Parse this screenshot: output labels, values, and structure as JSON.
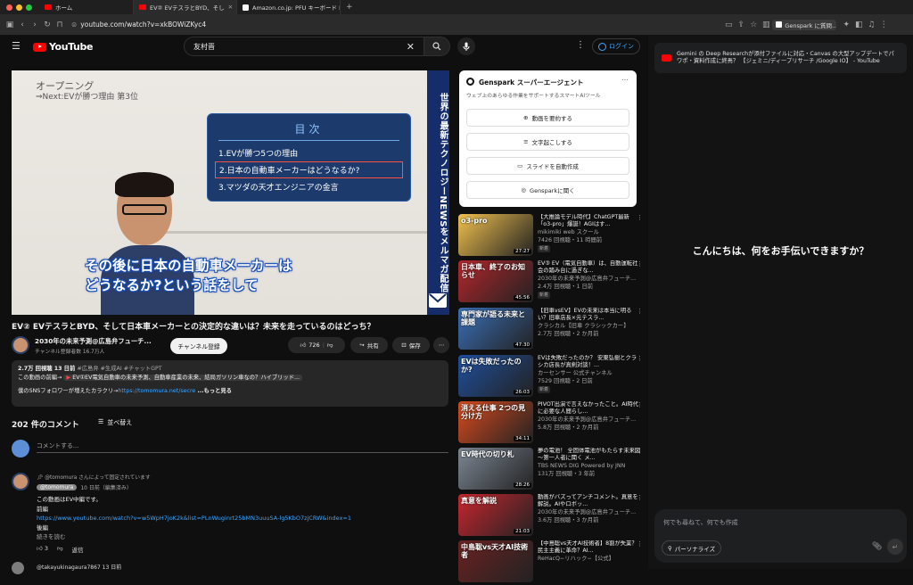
{
  "browser": {
    "tabs": [
      {
        "label": "ホーム"
      },
      {
        "label": "EV② EVテスラとBYD、そし"
      },
      {
        "label": "Amazon.co.jp: PFU キーボード HHK"
      }
    ],
    "url": "youtube.com/watch?v=xkBOWiZKyc4",
    "right_tab_label": "Genspark に質問...",
    "colors": {
      "close": "#ff5f57",
      "min": "#febc2e",
      "max": "#28c840"
    }
  },
  "youtube": {
    "logo_text": "YouTube",
    "search_value": "友村晋",
    "login_label": "ログイン",
    "video": {
      "overlay_title": "オープニング",
      "overlay_next": "⇒Next:EVが勝つ理由 第3位",
      "toc_heading": "目次",
      "toc_items": [
        "1.EVが勝つ5つの理由",
        "2.日本の自動車メーカーはどうなるか?",
        "3.マツダの天才エンジニアの金言"
      ],
      "side_banner": "世界の最新テクノロジーNEWSをメルマガ配信",
      "caption_line1": "その後に日本の自動車メーカーは",
      "caption_line2": "どうなるか?という話をして"
    },
    "title": "EV② EVテスラとBYD、そして日本車メーカーとの決定的な違いは？未来を走っているのはどっち？",
    "channel": {
      "name": "2030年の未来予測@広島弁フューチ...",
      "subs": "チャンネル登録者数 16.7万人",
      "subscribe_label": "チャンネル登録"
    },
    "actions": {
      "likes": "726",
      "share": "共有",
      "save": "保存"
    },
    "description": {
      "stats": "2.7万 回視聴  13 日前",
      "tags": "#広島弁 #生成AI #チャットGPT",
      "line1": "この動画の前編→",
      "line1_link": "EV①EV電気自動車の未来予測、自動車産業の未来、結局ガソリン車なの？ハイブリッド...",
      "line2": "僕のSNSフォロワーが増えたカラクリ→",
      "line2_link": "https://tomomura.net/secre",
      "more": "...もっと見る"
    },
    "comments": {
      "count": "202 件のコメント",
      "sort": "並べ替え",
      "placeholder": "コメントする...",
      "pinned": "@tomomura さんによって固定されています",
      "author": "@tomomura",
      "when": "10 日前（編集済み）",
      "body1": "この動画はEV中編です。",
      "body2": "前編",
      "link": "https://www.youtube.com/watch?v=w5WpH7joK2k&list=PLnWuginrt25bMN3uuuSA-lg5KbO7zjCRW&index=1",
      "body3": "後編",
      "more": "続きを読む",
      "likes": "3",
      "reply": "返信",
      "next_author": "@takayukinagaura7867  13 日前"
    }
  },
  "genspark": {
    "title": "Genspark スーパーエージェント",
    "subtitle": "ウェブ上のあらゆる作業をサポートするスマートAIツール",
    "buttons": [
      "動画を要約する",
      "文字起こしする",
      "スライドを自動作成",
      "Gensparkに聞く"
    ]
  },
  "recommendations": [
    {
      "thumb": "o3-pro",
      "duration": "27:27",
      "title": "【大推論モデル時代】ChatGPT最新「o3-pro」爆誕！AGIはす...",
      "channel": "mikimiki web スクール",
      "stats": "7426 回視聴・11 時間前",
      "badge": "新着",
      "color": "#f2c14e"
    },
    {
      "thumb": "日本車、終了のお知らせ",
      "duration": "45:56",
      "title": "EV③ EV（電気自動車）は、自動運転社会の踏み台に過ぎな...",
      "channel": "2030年の未来予測@広島弁フューチ...",
      "stats": "2.4万 回視聴・1 日前",
      "badge": "新着",
      "color": "#b3262b"
    },
    {
      "thumb": "専門家が語る未来と課題",
      "duration": "47:30",
      "title": "【旧車vsEV】EVの未来は本当に明るい？旧車店長×元テスラ...",
      "channel": "クラシカル【旧車 クラシックカー】",
      "stats": "2.7万 回視聴・2 か月前",
      "badge": "",
      "color": "#3a6fb7"
    },
    {
      "thumb": "EVは失敗だったのか?",
      "duration": "26:03",
      "title": "EVは失敗だったのか？ 安東弘樹とクラシカ店長が真剣対談！...",
      "channel": "カーセンサー 公式チャンネル",
      "stats": "7529 回視聴・2 日前",
      "badge": "新着",
      "color": "#1f4f9c"
    },
    {
      "thumb": "消える仕事 2つの見分け方",
      "duration": "34:11",
      "title": "PIVOT出演で言えなかったこと。AI時代に必要な人間らし...",
      "channel": "2030年の未来予測@広島弁フューチ...",
      "stats": "5.8万 回視聴・2 か月前",
      "badge": "",
      "color": "#d94a1e"
    },
    {
      "thumb": "EV時代の切り札",
      "duration": "28:26",
      "title": "夢の電池！ 全固体電池がもたらす未来図 ～第一人者に聞く メ...",
      "channel": "TBS NEWS DIG Powered by JNN",
      "stats": "131万 回視聴・3 年前",
      "badge": "",
      "color": "#7d8794"
    },
    {
      "thumb": "真意を解説",
      "duration": "21:03",
      "title": "動画がバズってアンチコメント。真意を解説。AIやロボッ...",
      "channel": "2030年の未来予測@広島弁フューチ...",
      "stats": "3.6万 回視聴・3 か月前",
      "badge": "",
      "color": "#c7262e"
    },
    {
      "thumb": "中島聡vs天才AI技術者",
      "duration": "",
      "title": "【中島聡vs天才AI技術者】8割が失業？民主主義に革命？AI...",
      "channel": "ReHacQ−リハック−【公式】",
      "stats": "",
      "badge": "",
      "color": "#6b2121"
    }
  ],
  "gemini": {
    "page_ref": "Gemini の Deep Researchが添付ファイルに対応・Canvas の大型アップデートでパワポ・資料作成に終焉？ 【ジェミニ/ディープリサーチ /Google IO】 - YouTube",
    "greeting": "こんにちは、何をお手伝いできますか？",
    "input_placeholder": "何でも尋ねて、何でも作成",
    "personalize": "パーソナライズ"
  }
}
